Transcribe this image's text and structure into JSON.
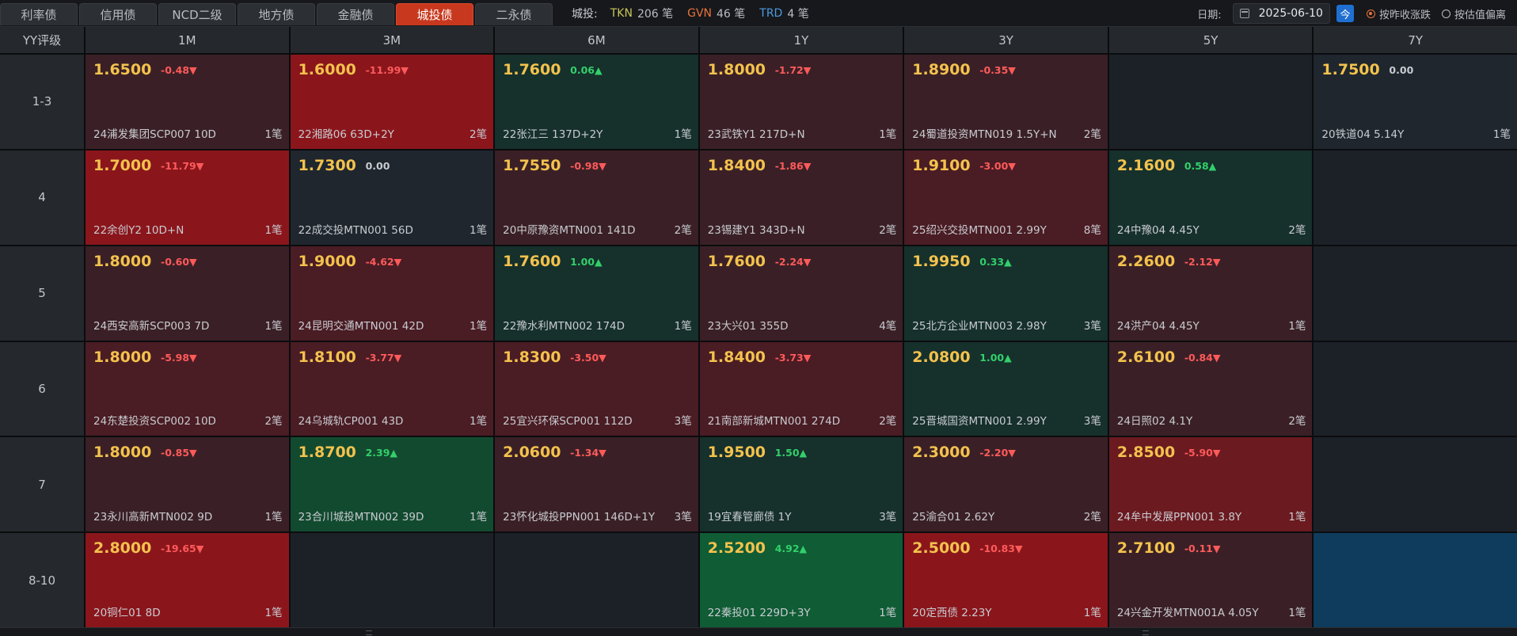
{
  "tabs": [
    {
      "label": "利率债",
      "active": false
    },
    {
      "label": "信用债",
      "active": false
    },
    {
      "label": "NCD二级",
      "active": false
    },
    {
      "label": "地方债",
      "active": false
    },
    {
      "label": "金融债",
      "active": false
    },
    {
      "label": "城投债",
      "active": true
    },
    {
      "label": "二永债",
      "active": false
    }
  ],
  "counts": {
    "label": "城投:",
    "tkn_key": "TKN",
    "tkn_val": "206 笔",
    "gvn_key": "GVN",
    "gvn_val": "46 笔",
    "trd_key": "TRD",
    "trd_val": "4 笔"
  },
  "date_filter": {
    "label": "日期:",
    "value": "2025-06-10",
    "today_label": "今",
    "radio_1": "按昨收涨跌",
    "radio_2": "按估值偏离",
    "selected": 1
  },
  "grid": {
    "corner": "YY评级",
    "columns": [
      "1M",
      "3M",
      "6M",
      "1Y",
      "3Y",
      "5Y",
      "7Y"
    ],
    "rows": [
      {
        "label": "1-3",
        "cells": [
          {
            "price": "1.6500",
            "change": "-0.48▼",
            "dir": "dn",
            "bond": "24浦发集团SCP007 10D",
            "count": "1笔",
            "tone": "darkred"
          },
          {
            "price": "1.6000",
            "change": "-11.99▼",
            "dir": "dn",
            "bond": "22湘路06 63D+2Y",
            "count": "2笔",
            "tone": "red3"
          },
          {
            "price": "1.7600",
            "change": "0.06▲",
            "dir": "up",
            "bond": "22张江三 137D+2Y",
            "count": "1笔",
            "tone": "green1"
          },
          {
            "price": "1.8000",
            "change": "-1.72▼",
            "dir": "dn",
            "bond": "23武铁Y1 217D+N",
            "count": "1笔",
            "tone": "darkred"
          },
          {
            "price": "1.8900",
            "change": "-0.35▼",
            "dir": "dn",
            "bond": "24蜀道投资MTN019 1.5Y+N",
            "count": "2笔",
            "tone": "darkred"
          },
          null,
          {
            "price": "1.7500",
            "change": "0.00",
            "dir": "flat",
            "bond": "20铁道04 5.14Y",
            "count": "1笔",
            "tone": "neutral"
          }
        ]
      },
      {
        "label": "4",
        "cells": [
          {
            "price": "1.7000",
            "change": "-11.79▼",
            "dir": "dn",
            "bond": "22余创Y2 10D+N",
            "count": "1笔",
            "tone": "red3"
          },
          {
            "price": "1.7300",
            "change": "0.00",
            "dir": "flat",
            "bond": "22成交投MTN001 56D",
            "count": "1笔",
            "tone": "neutral"
          },
          {
            "price": "1.7550",
            "change": "-0.98▼",
            "dir": "dn",
            "bond": "20中原豫资MTN001 141D",
            "count": "2笔",
            "tone": "darkred"
          },
          {
            "price": "1.8400",
            "change": "-1.86▼",
            "dir": "dn",
            "bond": "23锡建Y1 343D+N",
            "count": "2笔",
            "tone": "darkred"
          },
          {
            "price": "1.9100",
            "change": "-3.00▼",
            "dir": "dn",
            "bond": "25绍兴交投MTN001 2.99Y",
            "count": "8笔",
            "tone": "red1"
          },
          {
            "price": "2.1600",
            "change": "0.58▲",
            "dir": "up",
            "bond": "24中豫04 4.45Y",
            "count": "2笔",
            "tone": "green1"
          },
          null
        ]
      },
      {
        "label": "5",
        "cells": [
          {
            "price": "1.8000",
            "change": "-0.60▼",
            "dir": "dn",
            "bond": "24西安高新SCP003 7D",
            "count": "1笔",
            "tone": "darkred"
          },
          {
            "price": "1.9000",
            "change": "-4.62▼",
            "dir": "dn",
            "bond": "24昆明交通MTN001 42D",
            "count": "1笔",
            "tone": "red1"
          },
          {
            "price": "1.7600",
            "change": "1.00▲",
            "dir": "up",
            "bond": "22豫水利MTN002 174D",
            "count": "1笔",
            "tone": "green1"
          },
          {
            "price": "1.7600",
            "change": "-2.24▼",
            "dir": "dn",
            "bond": "23大兴01 355D",
            "count": "4笔",
            "tone": "darkred"
          },
          {
            "price": "1.9950",
            "change": "0.33▲",
            "dir": "up",
            "bond": "25北方企业MTN003 2.98Y",
            "count": "3笔",
            "tone": "green1"
          },
          {
            "price": "2.2600",
            "change": "-2.12▼",
            "dir": "dn",
            "bond": "24洪产04 4.45Y",
            "count": "1笔",
            "tone": "darkred"
          },
          null
        ]
      },
      {
        "label": "6",
        "cells": [
          {
            "price": "1.8000",
            "change": "-5.98▼",
            "dir": "dn",
            "bond": "24东楚投资SCP002 10D",
            "count": "2笔",
            "tone": "red1"
          },
          {
            "price": "1.8100",
            "change": "-3.77▼",
            "dir": "dn",
            "bond": "24乌城轨CP001 43D",
            "count": "1笔",
            "tone": "red1"
          },
          {
            "price": "1.8300",
            "change": "-3.50▼",
            "dir": "dn",
            "bond": "25宜兴环保SCP001 112D",
            "count": "3笔",
            "tone": "red1"
          },
          {
            "price": "1.8400",
            "change": "-3.73▼",
            "dir": "dn",
            "bond": "21南部新城MTN001 274D",
            "count": "2笔",
            "tone": "red1"
          },
          {
            "price": "2.0800",
            "change": "1.00▲",
            "dir": "up",
            "bond": "25晋城国资MTN001 2.99Y",
            "count": "3笔",
            "tone": "green1"
          },
          {
            "price": "2.6100",
            "change": "-0.84▼",
            "dir": "dn",
            "bond": "24日照02 4.1Y",
            "count": "2笔",
            "tone": "darkred"
          },
          null
        ]
      },
      {
        "label": "7",
        "cells": [
          {
            "price": "1.8000",
            "change": "-0.85▼",
            "dir": "dn",
            "bond": "23永川高新MTN002 9D",
            "count": "1笔",
            "tone": "darkred"
          },
          {
            "price": "1.8700",
            "change": "2.39▲",
            "dir": "up",
            "bond": "23合川城投MTN002 39D",
            "count": "1笔",
            "tone": "green2"
          },
          {
            "price": "2.0600",
            "change": "-1.34▼",
            "dir": "dn",
            "bond": "23怀化城投PPN001 146D+1Y",
            "count": "3笔",
            "tone": "darkred"
          },
          {
            "price": "1.9500",
            "change": "1.50▲",
            "dir": "up",
            "bond": "19宜春管廊债 1Y",
            "count": "3笔",
            "tone": "green1"
          },
          {
            "price": "2.3000",
            "change": "-2.20▼",
            "dir": "dn",
            "bond": "25渝合01 2.62Y",
            "count": "2笔",
            "tone": "darkred"
          },
          {
            "price": "2.8500",
            "change": "-5.90▼",
            "dir": "dn",
            "bond": "24牟中发展PPN001 3.8Y",
            "count": "1笔",
            "tone": "red2"
          },
          null
        ]
      },
      {
        "label": "8-10",
        "cells": [
          {
            "price": "2.8000",
            "change": "-19.65▼",
            "dir": "dn",
            "bond": "20铜仁01 8D",
            "count": "1笔",
            "tone": "red3"
          },
          null,
          null,
          {
            "price": "2.5200",
            "change": "4.92▲",
            "dir": "up",
            "bond": "22秦投01 229D+3Y",
            "count": "1笔",
            "tone": "green3"
          },
          {
            "price": "2.5000",
            "change": "-10.83▼",
            "dir": "dn",
            "bond": "20定西债 2.23Y",
            "count": "1笔",
            "tone": "red3"
          },
          {
            "price": "2.7100",
            "change": "-0.11▼",
            "dir": "dn",
            "bond": "24兴金开发MTN001A 4.05Y",
            "count": "1笔",
            "tone": "darkred"
          },
          {
            "empty_tone": "blue"
          }
        ]
      }
    ]
  },
  "colors": {
    "active_tab": "#c8381e",
    "price": "#f3c24d",
    "down": "#ff5a5a",
    "up": "#32d06a",
    "today_button": "#1f6fd1"
  }
}
